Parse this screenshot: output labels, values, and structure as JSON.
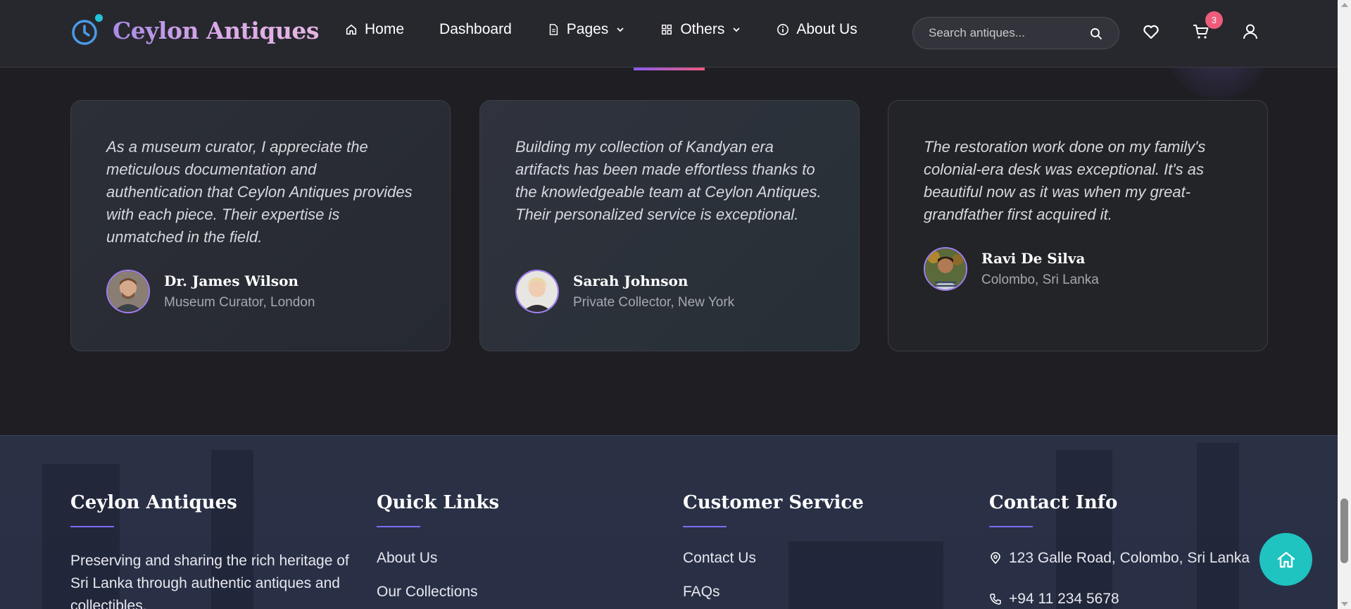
{
  "brand": {
    "name": "Ceylon Antiques"
  },
  "nav": {
    "items": [
      {
        "label": "Home",
        "icon": "home-icon"
      },
      {
        "label": "Dashboard"
      },
      {
        "label": "Pages",
        "icon": "document-icon",
        "dropdown": true
      },
      {
        "label": "Others",
        "icon": "grid-icon",
        "dropdown": true
      },
      {
        "label": "About Us",
        "icon": "info-icon"
      }
    ]
  },
  "search": {
    "placeholder": "Search antiques..."
  },
  "cart": {
    "count": "3"
  },
  "testimonials": [
    {
      "quote": "As a museum curator, I appreciate the meticulous documentation and authentication that Ceylon Antiques provides with each piece. Their expertise is unmatched in the field.",
      "name": "Dr. James Wilson",
      "role": "Museum Curator, London"
    },
    {
      "quote": "Building my collection of Kandyan era artifacts has been made effortless thanks to the knowledgeable team at Ceylon Antiques. Their personalized service is exceptional.",
      "name": "Sarah Johnson",
      "role": "Private Collector, New York"
    },
    {
      "quote": "The restoration work done on my family's colonial-era desk was exceptional. It's as beautiful now as it was when my great-grandfather first acquired it.",
      "name": "Ravi De Silva",
      "role": "Colombo, Sri Lanka"
    }
  ],
  "footer": {
    "about": {
      "title": "Ceylon Antiques",
      "desc": "Preserving and sharing the rich heritage of Sri Lanka through authentic antiques and collectibles."
    },
    "quick_links": {
      "title": "Quick Links",
      "links": [
        "About Us",
        "Our Collections"
      ]
    },
    "customer_service": {
      "title": "Customer Service",
      "links": [
        "Contact Us",
        "FAQs"
      ]
    },
    "contact": {
      "title": "Contact Info",
      "address": "123 Galle Road, Colombo, Sri Lanka",
      "phone": "+94 11 234 5678"
    }
  },
  "colors": {
    "accent": "#8a5cf0",
    "badge": "#ef5b7b",
    "teal": "#1fc3c0"
  }
}
